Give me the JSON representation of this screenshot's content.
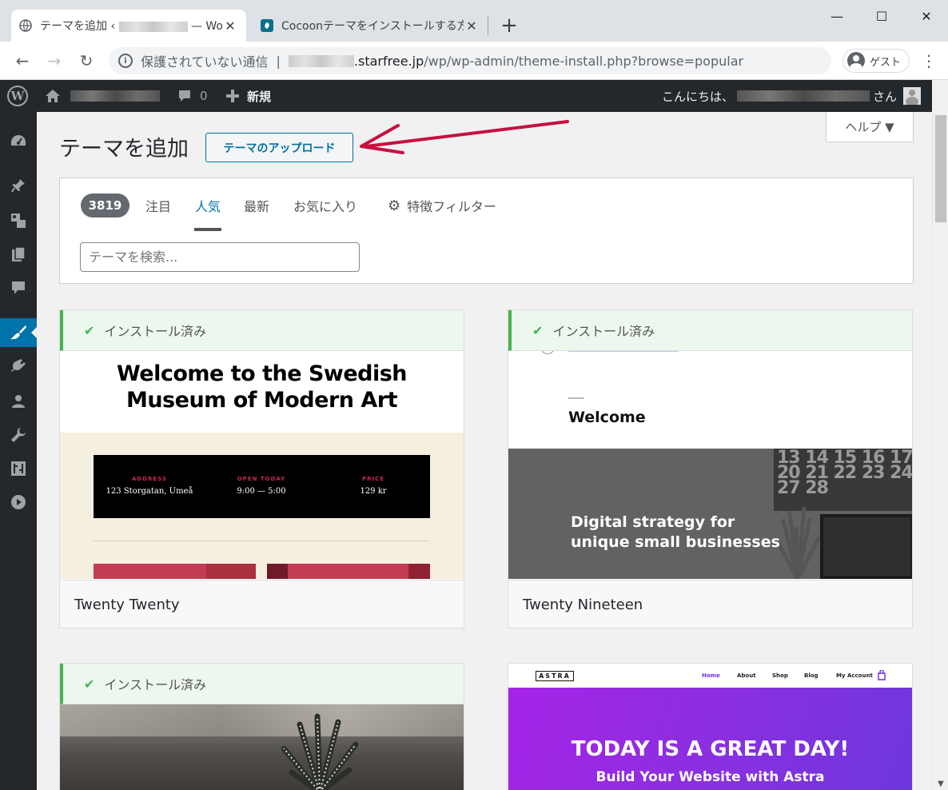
{
  "browser": {
    "tabs": [
      {
        "title": "テーマを追加 ‹ ",
        "title_tail": " — Word",
        "close": "✕"
      },
      {
        "title": "Cocoonテーマをインストールする方法",
        "close": "✕"
      }
    ],
    "new_tab": "+",
    "window_controls": {
      "minimize": "—",
      "maximize": "☐",
      "close": "✕"
    },
    "nav": {
      "back": "←",
      "forward": "→",
      "reload": "↻"
    },
    "address": {
      "info_glyph": "i",
      "security": "保護されていない通信",
      "separator": "|",
      "domain": ".starfree.jp",
      "path": "/wp/wp-admin/theme-install.php?browse=popular"
    },
    "profile": {
      "label": "ゲスト"
    },
    "menu_glyph": "⋮"
  },
  "adminbar": {
    "comments_count": "0",
    "new_label": "新規",
    "greeting": "こんにちは、",
    "greeting_suffix": "さん"
  },
  "header": {
    "title": "テーマを追加",
    "upload_button": "テーマのアップロード",
    "help": "ヘルプ ▼"
  },
  "filter": {
    "count": "3819",
    "tabs": [
      {
        "label": "注目"
      },
      {
        "label": "人気",
        "current": true
      },
      {
        "label": "最新"
      },
      {
        "label": "お気に入り"
      }
    ],
    "feature_filter": "特徴フィルター",
    "search_placeholder": "テーマを検索..."
  },
  "themes": [
    {
      "name": "Twenty Twenty",
      "installed": "インストール済み",
      "preview": {
        "heading_line1": "Welcome to the Swedish",
        "heading_line2": "Museum of Modern Art",
        "cols": [
          {
            "label": "ADDRESS",
            "value": "123 Storgatan, Umeå"
          },
          {
            "label": "OPEN TODAY",
            "value": "9:00 — 5:00"
          },
          {
            "label": "PRICE",
            "value": "129 kr"
          }
        ]
      }
    },
    {
      "name": "Twenty Nineteen",
      "installed": "インストール済み",
      "preview": {
        "welcome": "Welcome",
        "calendar": "13 14 15 16 17 20 21 22 23 24 27 28",
        "strategy_line1": "Digital strategy for",
        "strategy_line2": "unique small businesses"
      }
    },
    {
      "installed": "インストール済み"
    },
    {
      "preview": {
        "logo": "ASTRA",
        "nav": [
          "Home",
          "About",
          "Shop",
          "Blog",
          "My Account"
        ],
        "hero_title": "TODAY IS A GREAT DAY!",
        "hero_sub": "Build Your Website with Astra"
      }
    }
  ],
  "colors": {
    "wp_blue": "#0073aa",
    "adminbar": "#23282d",
    "installed_green": "#46b450",
    "annotation_arrow": "#c8103e",
    "astra_purple": "#8b2fe0"
  }
}
